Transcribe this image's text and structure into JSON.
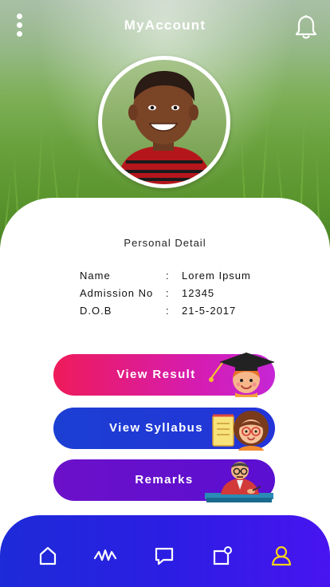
{
  "header": {
    "title": "MyAccount"
  },
  "profile": {
    "section_title": "Personal Detail",
    "fields": [
      {
        "label": "Name",
        "separator": ":",
        "value": "Lorem Ipsum"
      },
      {
        "label": "Admission No",
        "separator": ":",
        "value": "12345"
      },
      {
        "label": "D.O.B",
        "separator": ":",
        "value": "21-5-2017"
      }
    ]
  },
  "actions": {
    "view_result": "View Result",
    "view_syllabus": "View Syllabus",
    "remarks": "Remarks"
  },
  "nav": {
    "items": [
      "home-icon",
      "activity-icon",
      "chat-icon",
      "notice-icon",
      "profile-icon"
    ],
    "active": "profile-icon",
    "active_color": "#f6d21b"
  },
  "colors": {
    "result_start": "#ee1b5a",
    "result_end": "#c526d6",
    "syllabus": "#1c3fd3",
    "remarks": "#6c10c9",
    "nav": "#2b1ee3"
  }
}
